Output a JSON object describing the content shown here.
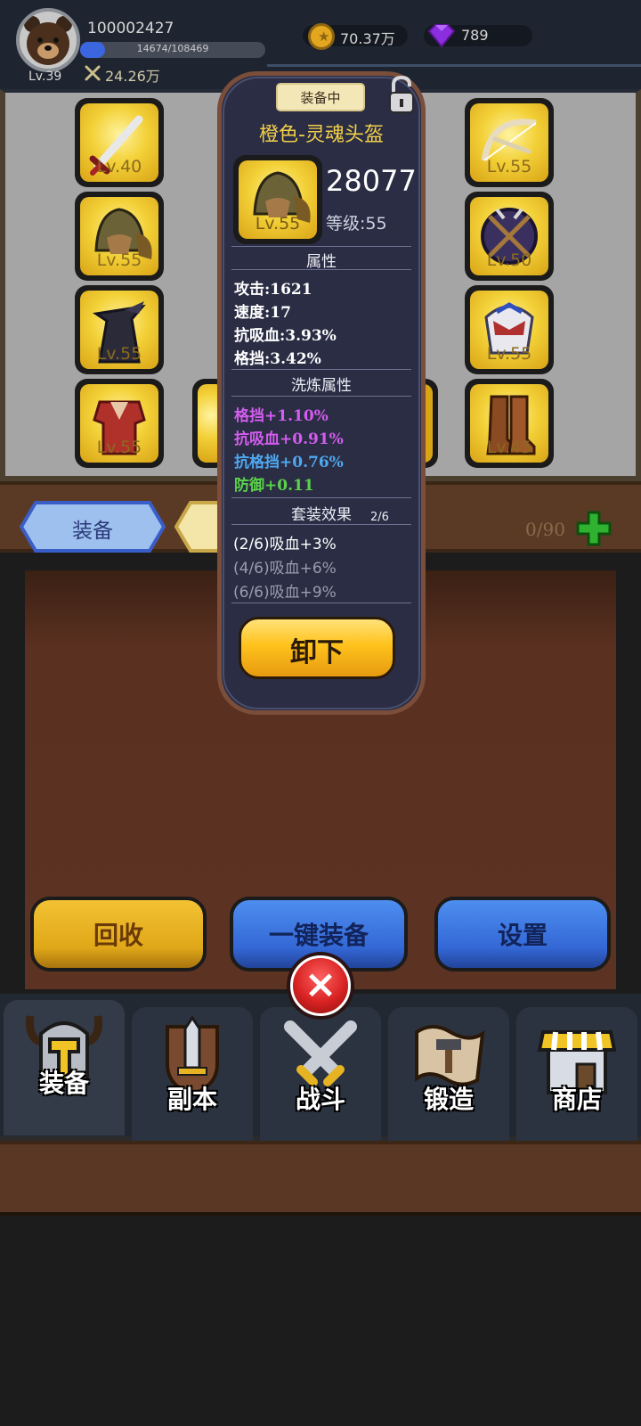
{
  "player": {
    "id": "100002427",
    "level": "Lv.39",
    "xp_text": "14674/108469",
    "xp_progress": 0.135,
    "power": "24.26万"
  },
  "currency": {
    "gold": "70.37万",
    "gems": "789"
  },
  "equipment_slots": {
    "left": [
      {
        "name": "weapon",
        "level": "Lv.40"
      },
      {
        "name": "helmet",
        "level": "Lv.55"
      },
      {
        "name": "cloak",
        "level": "Lv.55"
      },
      {
        "name": "armor",
        "level": "Lv.55"
      }
    ],
    "right": [
      {
        "name": "bow",
        "level": "Lv.55"
      },
      {
        "name": "shield",
        "level": "Lv.50"
      },
      {
        "name": "mask",
        "level": "Lv.55"
      },
      {
        "name": "boots",
        "level": "Lv.45"
      }
    ]
  },
  "tabs": {
    "equip": "装备",
    "bag_count": "0/90"
  },
  "popup": {
    "status_badge": "装备中",
    "item_name": "橙色-灵魂头盔",
    "item_level_badge": "Lv.55",
    "score": "28077",
    "level_text": "等级:55",
    "attributes_title": "属性",
    "attributes": [
      "攻击:1621",
      "速度:17",
      "抗吸血:3.93%",
      "格挡:3.42%"
    ],
    "refine_title": "洗炼属性",
    "refine": [
      {
        "text": "格挡+1.10%",
        "color": "#d45cf0"
      },
      {
        "text": "抗吸血+0.91%",
        "color": "#d45cf0"
      },
      {
        "text": "抗格挡+0.76%",
        "color": "#4fa8f0"
      },
      {
        "text": "防御+0.11",
        "color": "#5bd24a"
      }
    ],
    "set_title": "套装效果",
    "set_count": "2/6",
    "set_effects": [
      {
        "text": "(2/6)吸血+3%",
        "color": "#ffffff"
      },
      {
        "text": "(4/6)吸血+6%",
        "color": "#9a9db0"
      },
      {
        "text": "(6/6)吸血+9%",
        "color": "#9a9db0"
      }
    ],
    "unequip_label": "卸下"
  },
  "actions": {
    "recycle": "回收",
    "one_click_equip": "一键装备",
    "settings": "设置"
  },
  "nav": {
    "equip": "装备",
    "dungeon": "副本",
    "battle": "战斗",
    "forge": "锻造",
    "shop": "商店"
  },
  "colors": {
    "gold_text": "#f3d04a",
    "popup_bg": "#2a2d44",
    "tab_blue": "#3a5ec8"
  }
}
